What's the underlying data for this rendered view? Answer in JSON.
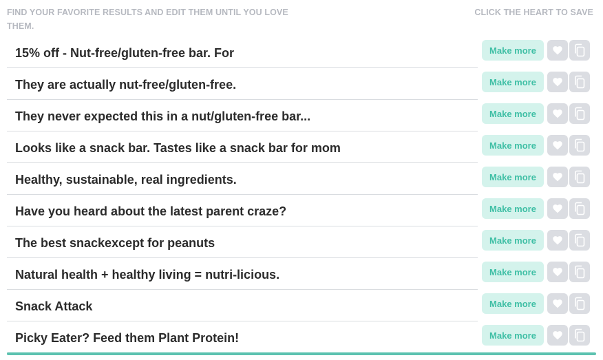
{
  "header": {
    "instructions": "FIND YOUR FAVORITE RESULTS AND EDIT THEM UNTIL YOU LOVE THEM.",
    "save_hint": "CLICK THE HEART TO SAVE"
  },
  "colors": {
    "make_more_bg": "#d4f3ec",
    "make_more_text": "#3fbfa5",
    "icon_button_bg": "#dbdde2",
    "accent_bar": "#5cc2b0"
  },
  "results": [
    {
      "text": "15% off - Nut-free/gluten-free bar. For",
      "make_more_label": "Make more",
      "heart_icon": "heart-icon",
      "copy_icon": "copy-icon"
    },
    {
      "text": "They are actually nut-free/gluten-free.",
      "make_more_label": "Make more",
      "heart_icon": "heart-icon",
      "copy_icon": "copy-icon"
    },
    {
      "text": "They never expected this in a nut/gluten-free bar...",
      "make_more_label": "Make more",
      "heart_icon": "heart-icon",
      "copy_icon": "copy-icon"
    },
    {
      "text": "Looks like a snack bar. Tastes like a snack bar for mom",
      "make_more_label": "Make more",
      "heart_icon": "heart-icon",
      "copy_icon": "copy-icon"
    },
    {
      "text": "Healthy, sustainable, real ingredients.",
      "make_more_label": "Make more",
      "heart_icon": "heart-icon",
      "copy_icon": "copy-icon"
    },
    {
      "text": "Have you heard about the latest parent craze?",
      "make_more_label": "Make more",
      "heart_icon": "heart-icon",
      "copy_icon": "copy-icon"
    },
    {
      "text": "The best snackexcept for peanuts",
      "make_more_label": "Make more",
      "heart_icon": "heart-icon",
      "copy_icon": "copy-icon"
    },
    {
      "text": "Natural health + healthy living = nutri-licious.",
      "make_more_label": "Make more",
      "heart_icon": "heart-icon",
      "copy_icon": "copy-icon"
    },
    {
      "text": "Snack Attack",
      "make_more_label": "Make more",
      "heart_icon": "heart-icon",
      "copy_icon": "copy-icon"
    },
    {
      "text": "Picky Eater? Feed them Plant Protein!",
      "make_more_label": "Make more",
      "heart_icon": "heart-icon",
      "copy_icon": "copy-icon"
    }
  ]
}
